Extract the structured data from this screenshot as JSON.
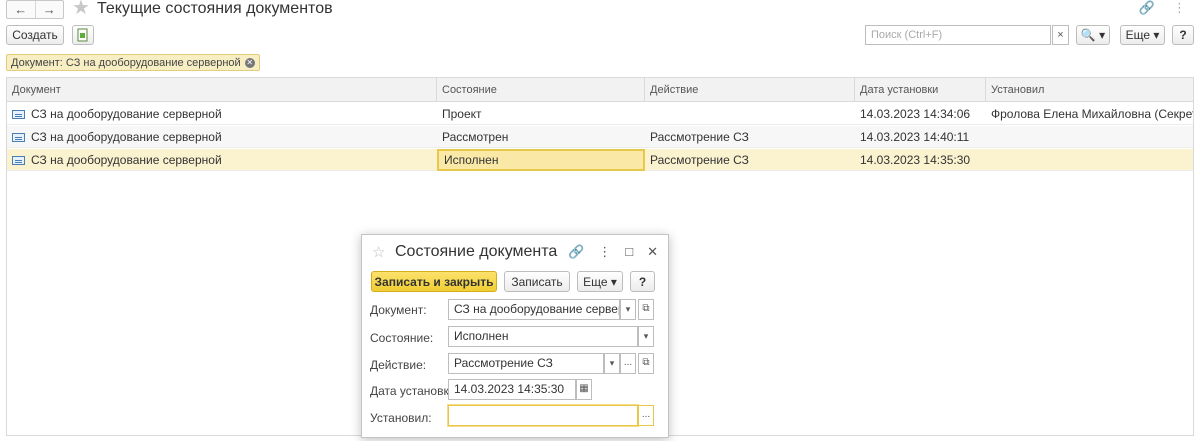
{
  "window": {
    "title": "Текущие состояния документов",
    "back_icon": "←",
    "forward_icon": "→",
    "star_icon": "★",
    "link_icon": "🔗",
    "menu_icon": "⋮"
  },
  "toolbar": {
    "create_label": "Создать",
    "search_placeholder": "Поиск (Ctrl+F)",
    "clear_label": "×",
    "search_label": "🔍 ▾",
    "more_label": "Еще ▾",
    "help_label": "?"
  },
  "filter": {
    "chip_label": "Документ: СЗ на дооборудование серверной",
    "remove_label": "✕"
  },
  "table": {
    "columns": [
      "Документ",
      "Состояние",
      "Действие",
      "Дата установки",
      "Установил"
    ],
    "rows": [
      {
        "document": "СЗ на дооборудование серверной",
        "state": "Проект",
        "action": "",
        "date": "14.03.2023 14:34:06",
        "user": "Фролова Елена Михайловна (Секретар..."
      },
      {
        "document": "СЗ на дооборудование серверной",
        "state": "Рассмотрен",
        "action": "Рассмотрение СЗ",
        "date": "14.03.2023 14:40:11",
        "user": ""
      },
      {
        "document": "СЗ на дооборудование серверной",
        "state": "Исполнен",
        "action": "Рассмотрение СЗ",
        "date": "14.03.2023 14:35:30",
        "user": ""
      }
    ]
  },
  "dialog": {
    "title": "Состояние документа",
    "star_icon": "☆",
    "link_icon": "🔗",
    "menu_icon": "⋮",
    "maximize_icon": "□",
    "close_icon": "✕",
    "save_close_label": "Записать и закрыть",
    "save_label": "Записать",
    "more_label": "Еще ▾",
    "help_label": "?",
    "fields": {
      "document_label": "Документ:",
      "document_value": "СЗ на дооборудование серверной",
      "state_label": "Состояние:",
      "state_value": "Исполнен",
      "action_label": "Действие:",
      "action_value": "Рассмотрение СЗ",
      "date_label": "Дата установки:",
      "date_value": "14.03.2023 14:35:30",
      "user_label": "Установил:",
      "user_value": ""
    },
    "dropdown_icon": "▾",
    "open_icon": "⧉",
    "select_icon": "...",
    "calendar_icon": "▦"
  },
  "colors": {
    "accent": "#f1cd34",
    "selection": "#fbf2d0",
    "chip": "#f7eec4"
  }
}
